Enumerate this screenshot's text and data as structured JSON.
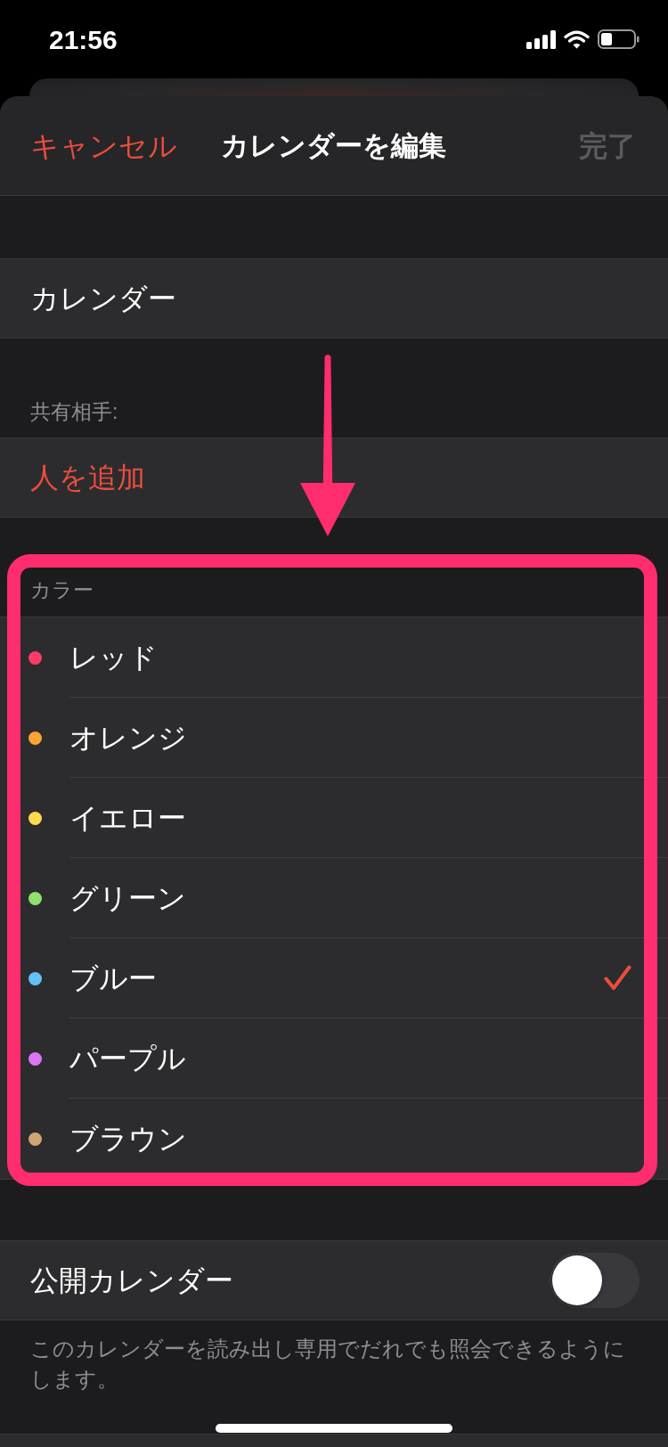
{
  "status_bar": {
    "time": "21:56"
  },
  "nav_bar": {
    "cancel": "キャンセル",
    "title": "カレンダーを編集",
    "done": {
      "label": "完了",
      "disabled": true
    }
  },
  "calendar_name": {
    "value": "カレンダー"
  },
  "sharing": {
    "header": "共有相手:",
    "add_person": "人を追加"
  },
  "colors": {
    "header": "カラー",
    "items": [
      {
        "label": "レッド",
        "color": "#fe3b69",
        "selected": false
      },
      {
        "label": "オレンジ",
        "color": "#f8a534",
        "selected": false
      },
      {
        "label": "イエロー",
        "color": "#fdd94d",
        "selected": false
      },
      {
        "label": "グリーン",
        "color": "#90e06e",
        "selected": false
      },
      {
        "label": "ブルー",
        "color": "#63c1f7",
        "selected": true
      },
      {
        "label": "パープル",
        "color": "#da76f2",
        "selected": false
      },
      {
        "label": "ブラウン",
        "color": "#cfa576",
        "selected": false
      }
    ]
  },
  "public_calendar": {
    "label": "公開カレンダー",
    "on": false,
    "footer": "このカレンダーを読み出し専用でだれでも照会できるようにします。"
  }
}
